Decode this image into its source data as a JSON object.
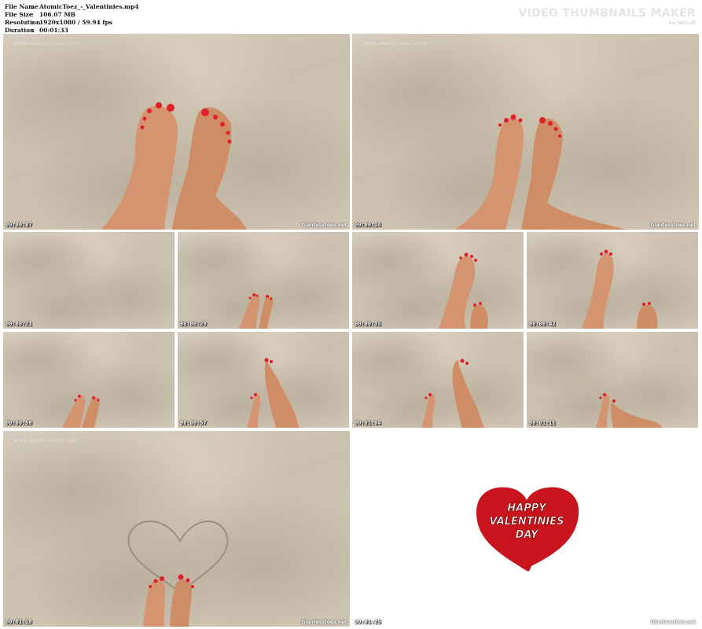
{
  "file_info": {
    "rows": [
      {
        "key": "File Name",
        "value": "AtomicToez_-_Valentinies.mp4"
      },
      {
        "key": "File Size",
        "value": "106.07 MB"
      },
      {
        "key": "Resolution",
        "value": "1920x1080 / 59.94 fps"
      },
      {
        "key": "Duration",
        "value": "00:01:33"
      }
    ],
    "separator": ":"
  },
  "watermark": {
    "title": "VIDEO THUMBNAILS MAKER",
    "by": "by iWisoft"
  },
  "site_logo": "Giantesstoes.net",
  "corner_mark": "www.atomictoez.com",
  "thumbnails": [
    {
      "timestamp": "00:00:07"
    },
    {
      "timestamp": "00:00:14"
    },
    {
      "timestamp": "00:00:21"
    },
    {
      "timestamp": "00:00:28"
    },
    {
      "timestamp": "00:00:35"
    },
    {
      "timestamp": "00:00:42"
    },
    {
      "timestamp": "00:00:50"
    },
    {
      "timestamp": "00:00:57"
    },
    {
      "timestamp": "00:01:04"
    },
    {
      "timestamp": "00:01:11"
    },
    {
      "timestamp": "00:01:18"
    },
    {
      "timestamp": "00:01:25"
    }
  ],
  "valentine_card": {
    "line1": "HAPPY",
    "line2": "VALENTINIES",
    "line3": "DAY",
    "heart_color": "#c8141c"
  },
  "colors": {
    "skin": "#d99a6e",
    "nail": "#e0202a",
    "concrete": "#cfc4b3"
  }
}
